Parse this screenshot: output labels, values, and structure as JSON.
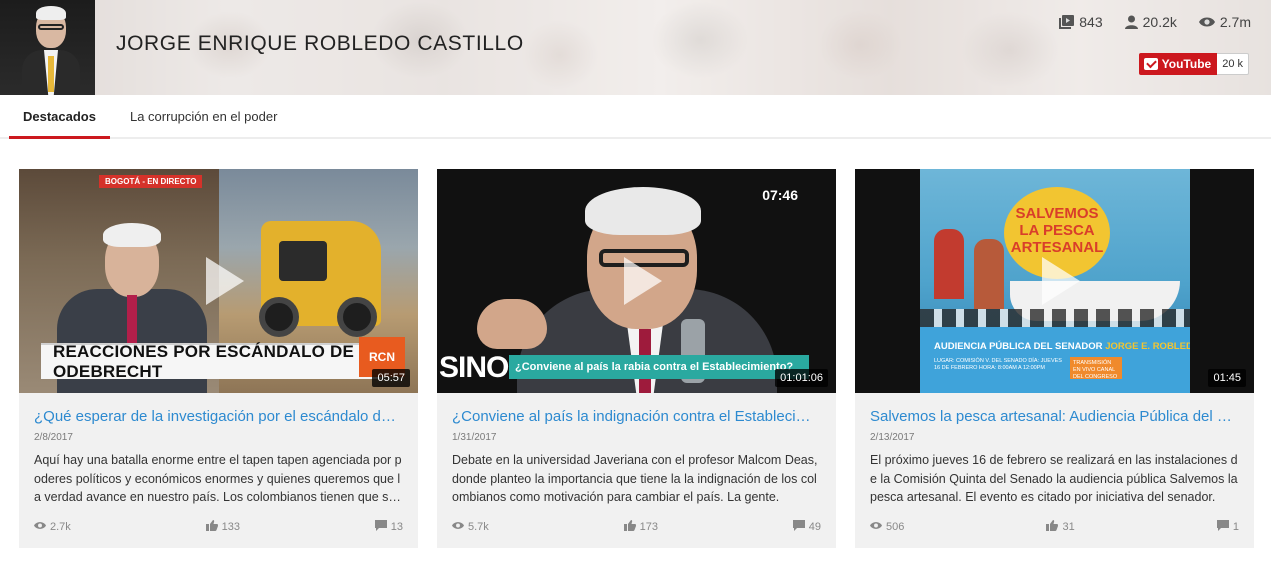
{
  "header": {
    "channel_title": "JORGE ENRIQUE ROBLEDO CASTILLO",
    "stats": [
      {
        "icon": "video-library-icon",
        "value": "843"
      },
      {
        "icon": "person-icon",
        "value": "20.2k"
      },
      {
        "icon": "eye-icon",
        "value": "2.7m"
      }
    ],
    "youtube_label": "YouTube",
    "youtube_count": "20 k"
  },
  "tabs": [
    {
      "label": "Destacados",
      "active": true
    },
    {
      "label": "La corrupción en el poder",
      "active": false
    }
  ],
  "videos": [
    {
      "thumb_text": {
        "banner": "REACCIONES POR ESCÁNDALO DE ODEBRECHT",
        "top": "BOGOTÁ - EN DIRECTO",
        "logo": "RCN"
      },
      "duration": "05:57",
      "title": "¿Qué esperar de la investigación por el escándalo de Odebrecht?",
      "date": "2/8/2017",
      "description": "Aquí hay una batalla enorme entre el tapen tapen agenciada por poderes políticos y económicos enormes y quienes queremos que la verdad avance en nuestro país. Los colombianos tienen que saberlo.",
      "views": "2.7k",
      "likes": "133",
      "comments": "13"
    },
    {
      "thumb_text": {
        "time": "07:46",
        "logo": "SINO",
        "lower": "¿Conviene al país la rabia contra el Establecimiento?"
      },
      "duration": "01:01:06",
      "title": "¿Conviene al país la indignación contra el Establecimiento?",
      "date": "1/31/2017",
      "description": "Debate en la universidad Javeriana con el profesor Malcom Deas, donde planteo la importancia que tiene la la indignación de los colombianos como motivación para cambiar el país. La gente.",
      "views": "5.7k",
      "likes": "173",
      "comments": "49"
    },
    {
      "thumb_text": {
        "poster_title": "SALVEMOS LA PESCA ARTESANAL",
        "lower": "AUDIENCIA PÚBLICA DEL SENADOR",
        "lower_name": "JORGE E. ROBLEDO",
        "small": "LUGAR: COMISIÓN V. DEL SENADO DÍA: JUEVES 16 DE FEBRERO HORA: 8:00AM A 12:00PM",
        "tag": "TRANSMISIÓN EN VIVO CANAL DEL CONGRESO"
      },
      "duration": "01:45",
      "title": "Salvemos la pesca artesanal: Audiencia Pública del senador Jorge Robledo",
      "date": "2/13/2017",
      "description": "El próximo jueves 16 de febrero se realizará en las instalaciones de la Comisión Quinta del Senado la audiencia pública Salvemos la pesca artesanal. El evento es citado por iniciativa del senador.",
      "views": "506",
      "likes": "31",
      "comments": "1"
    }
  ],
  "colors": {
    "accent": "#cc181e",
    "link": "#2d8ad0"
  }
}
